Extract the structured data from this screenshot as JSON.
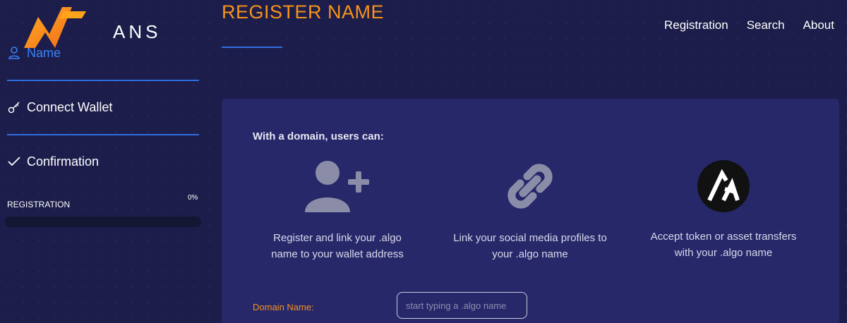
{
  "brand": {
    "logo_text": "ANS",
    "accent": "#f7931a",
    "blue": "#2f6fe0"
  },
  "sidebar": {
    "steps": [
      {
        "label": "Name",
        "icon": "user-icon",
        "active": true
      },
      {
        "label": "Connect Wallet",
        "icon": "key-icon",
        "active": false
      },
      {
        "label": "Confirmation",
        "icon": "check-icon",
        "active": false
      }
    ],
    "registration": {
      "label": "REGISTRATION",
      "percent_text": "0%",
      "progress": 0
    }
  },
  "header": {
    "title": "REGISTER NAME",
    "nav": [
      "Registration",
      "Search",
      "About"
    ]
  },
  "card": {
    "heading": "With a domain, users can:",
    "features": [
      {
        "icon": "add-user-icon",
        "text_line1": "Register and link your .algo",
        "text_line2": "name to your wallet address"
      },
      {
        "icon": "link-icon",
        "text_line1": "Link your social media profiles to",
        "text_line2": "your .algo name"
      },
      {
        "icon": "algorand-icon",
        "text_line1": "Accept token or asset transfers",
        "text_line2": "with your .algo name"
      }
    ],
    "domain_label": "Domain Name:",
    "domain_placeholder": "start typing a .algo name",
    "domain_value": ""
  }
}
